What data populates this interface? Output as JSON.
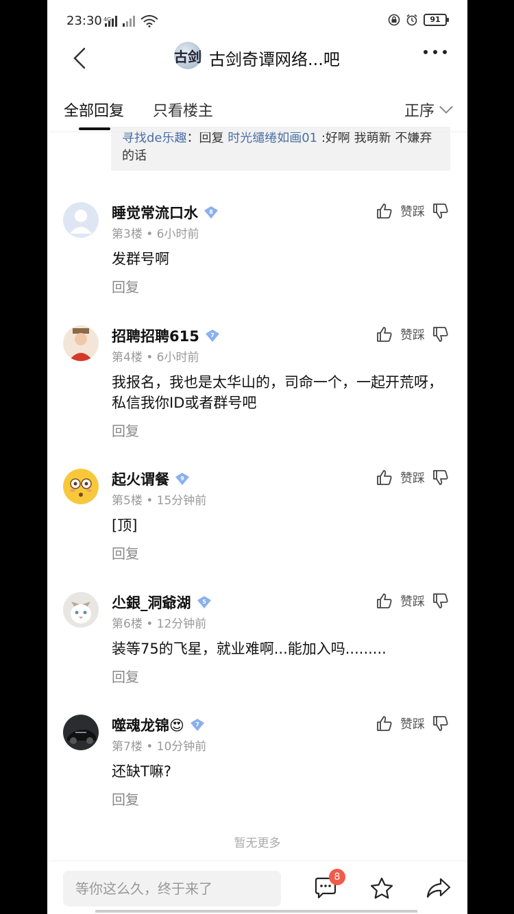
{
  "status_bar": {
    "time": "23:30",
    "network": "4G",
    "battery": "91"
  },
  "header": {
    "forum_logo_text": "古剑",
    "title": "古剑奇谭网络...吧"
  },
  "tabs": {
    "all_replies": "全部回复",
    "op_only": "只看楼主",
    "sort_label": "正序"
  },
  "quote": {
    "author": "寻找de乐趣",
    "sep": "：回复 ",
    "target": "时光缱绻如画01",
    "text": " :好啊 我萌新 不嫌弃的话"
  },
  "posts": [
    {
      "username": "睡觉常流口水",
      "level": "8",
      "floor": "第3楼",
      "time": "6小时前",
      "content": "发群号啊",
      "reply_label": "回复",
      "vote_label": "赞踩"
    },
    {
      "username": "招聘招聘615",
      "level": "7",
      "floor": "第4楼",
      "time": "6小时前",
      "content": "我报名，我也是太华山的，司命一个，一起开荒呀，私信我你ID或者群号吧",
      "reply_label": "回复",
      "vote_label": "赞踩"
    },
    {
      "username": "起火谓餐",
      "level": "9",
      "floor": "第5楼",
      "time": "15分钟前",
      "content": "[顶]",
      "reply_label": "回复",
      "vote_label": "赞踩"
    },
    {
      "username": "尐銀_洞爺湖",
      "level": "5",
      "floor": "第6楼",
      "time": "12分钟前",
      "content": "装等75的飞星，就业难啊...能加入吗.........",
      "reply_label": "回复",
      "vote_label": "赞踩"
    },
    {
      "username": "噬魂龙锦😍",
      "level": "7",
      "floor": "第7楼",
      "time": "10分钟前",
      "content": "还缺T嘛?",
      "reply_label": "回复",
      "vote_label": "赞踩"
    }
  ],
  "meta_sep": " • ",
  "footer": {
    "no_more": "暂无更多",
    "input_placeholder": "等你这么久，终于来了",
    "comment_badge": "8"
  }
}
